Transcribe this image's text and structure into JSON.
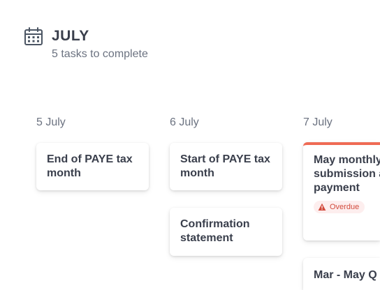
{
  "header": {
    "title": "JULY",
    "subtitle": "5 tasks to complete",
    "icon": "calendar-icon"
  },
  "columns": [
    {
      "date": "5 July",
      "tasks": [
        {
          "title": "End of PAYE tax month",
          "status": ""
        }
      ]
    },
    {
      "date": "6 July",
      "tasks": [
        {
          "title": "Start of PAYE tax month",
          "status": ""
        },
        {
          "title": "Confirmation statement",
          "status": ""
        }
      ]
    },
    {
      "date": "7 July",
      "tasks": [
        {
          "title": "May monthly Return submission and payment",
          "status": "Overdue"
        },
        {
          "title": "Mar - May Q return",
          "status": ""
        }
      ]
    }
  ],
  "colors": {
    "text": "#3a3f4c",
    "muted": "#6b7280",
    "overdue_accent": "#ef6b55",
    "overdue_text": "#d24a3c",
    "overdue_bg": "#fdeeee"
  }
}
